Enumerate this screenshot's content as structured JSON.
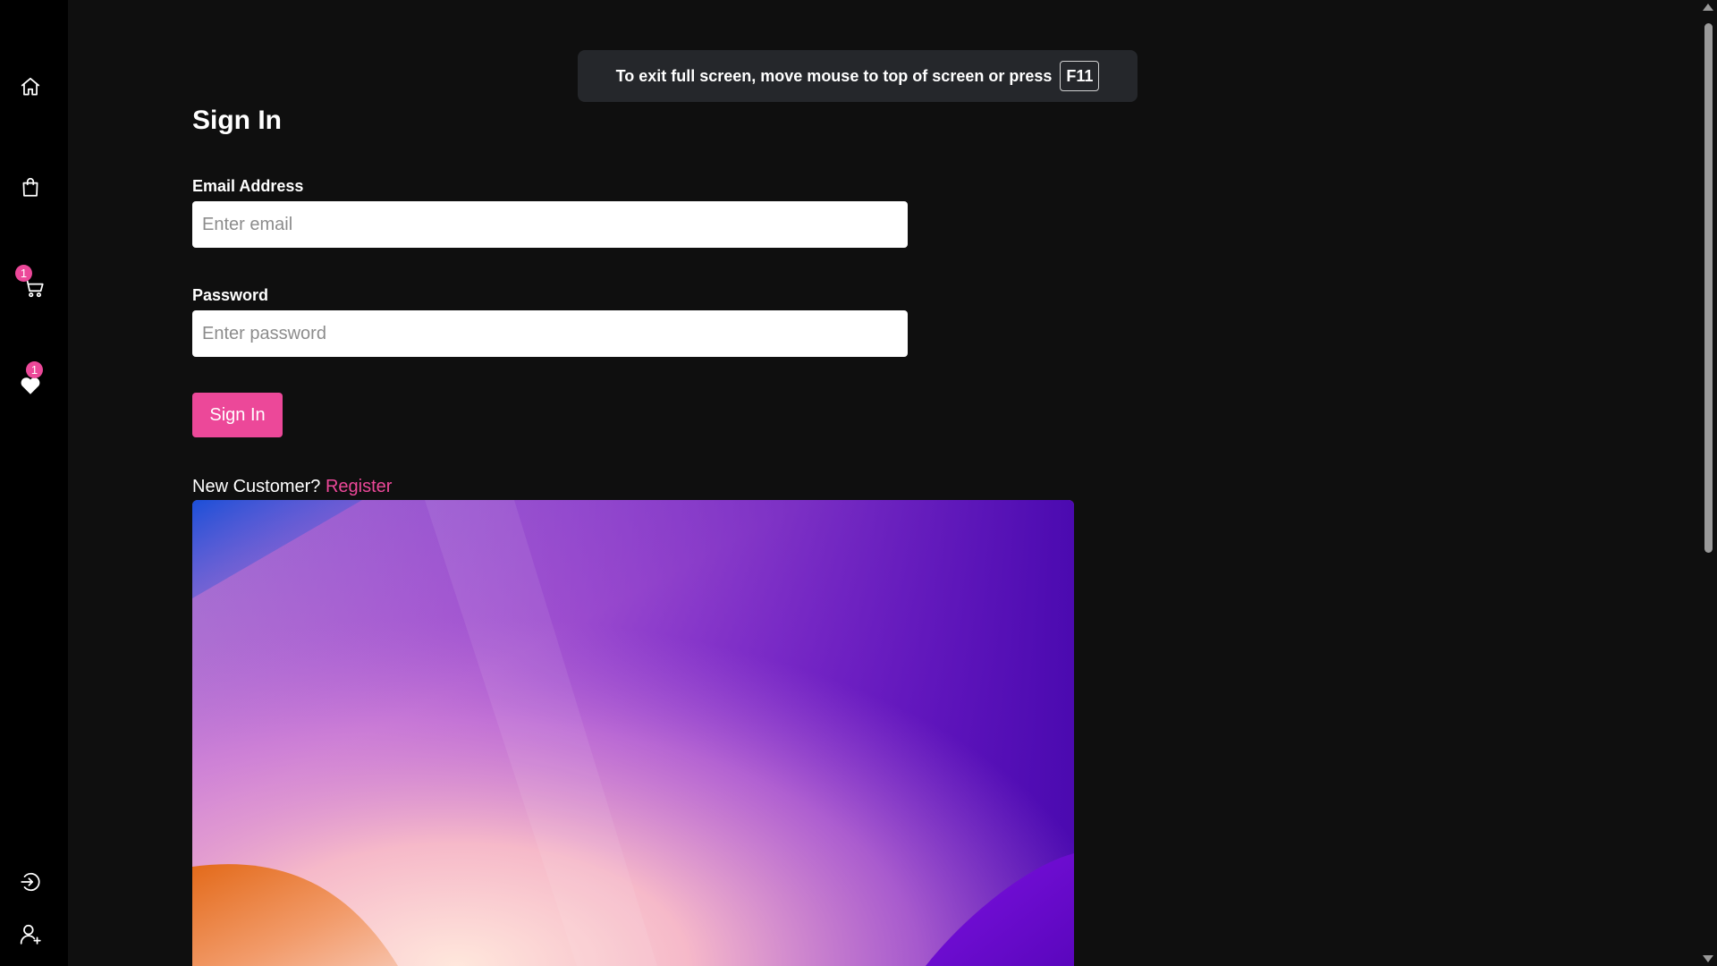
{
  "fullscreen_notice": {
    "text": "To exit full screen, move mouse to top of screen or press",
    "key": "F11"
  },
  "sidebar": {
    "items": [
      {
        "name": "home",
        "icon": "home-icon"
      },
      {
        "name": "shop",
        "icon": "shopping-bag-icon"
      },
      {
        "name": "cart",
        "icon": "cart-icon",
        "badge": "1"
      },
      {
        "name": "favorites",
        "icon": "heart-icon",
        "badge": "1"
      },
      {
        "name": "login",
        "icon": "login-icon"
      },
      {
        "name": "register",
        "icon": "user-plus-icon"
      }
    ]
  },
  "form": {
    "title": "Sign In",
    "email_label": "Email Address",
    "email_placeholder": "Enter email",
    "password_label": "Password",
    "password_placeholder": "Enter password",
    "submit_label": "Sign In",
    "new_customer_text": "New Customer?",
    "register_link": "Register"
  },
  "colors": {
    "accent": "#ec4899",
    "background": "#0f0f0f",
    "sidebar": "#000000"
  }
}
